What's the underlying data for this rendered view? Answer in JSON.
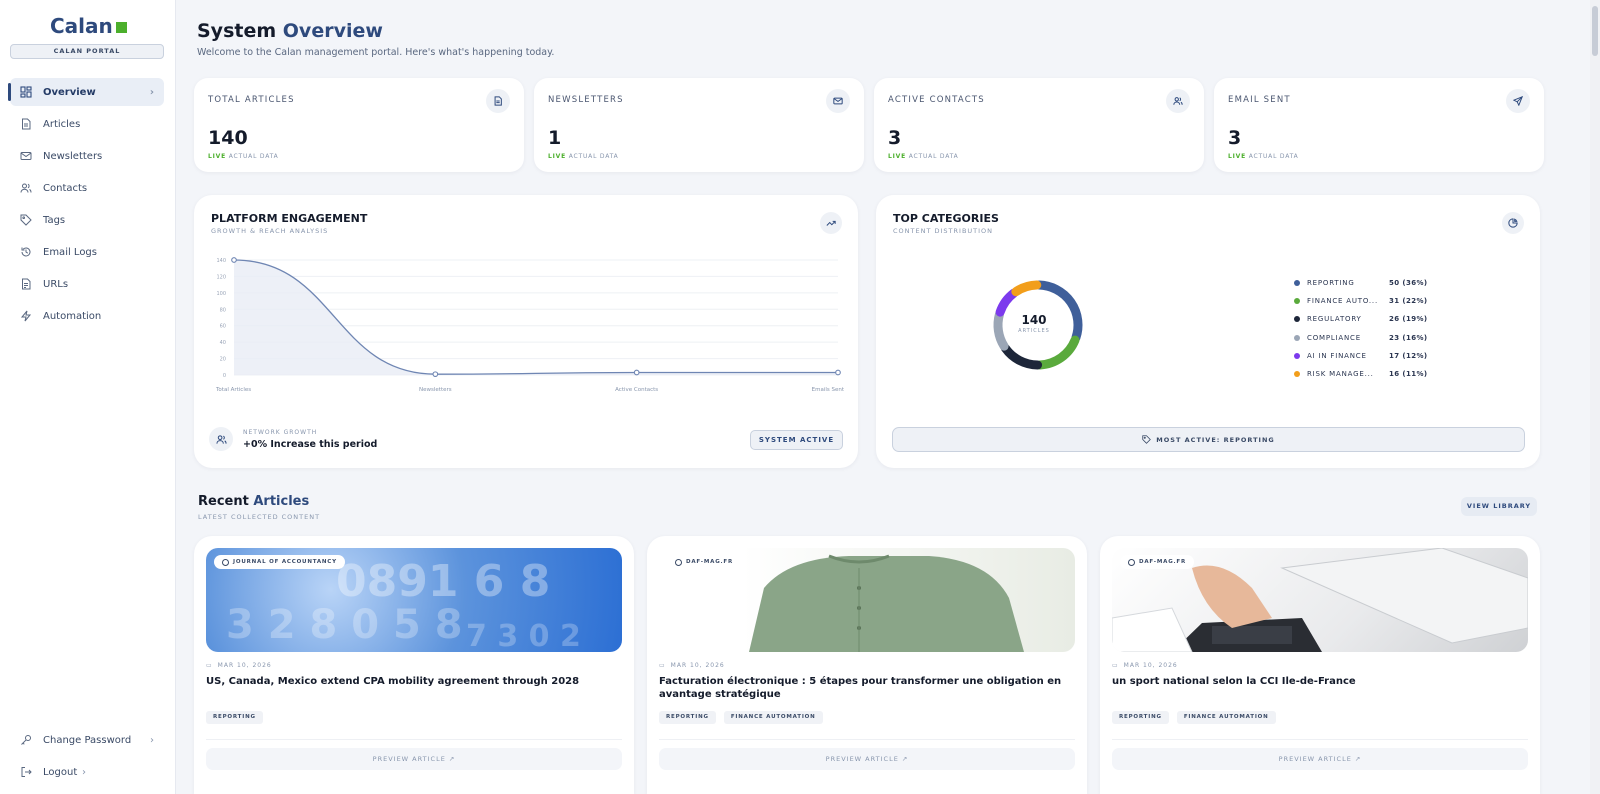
{
  "sidebar": {
    "logo": "Calan",
    "portal": "CALAN PORTAL",
    "items": [
      {
        "label": "Overview"
      },
      {
        "label": "Articles"
      },
      {
        "label": "Newsletters"
      },
      {
        "label": "Contacts"
      },
      {
        "label": "Tags"
      },
      {
        "label": "Email Logs"
      },
      {
        "label": "URLs"
      },
      {
        "label": "Automation"
      }
    ],
    "bottom": [
      {
        "label": "Change Password"
      },
      {
        "label": "Logout"
      }
    ]
  },
  "header": {
    "title_a": "System",
    "title_b": "Overview",
    "subtitle": "Welcome to the Calan management portal. Here's what's happening today."
  },
  "stats": [
    {
      "label": "TOTAL ARTICLES",
      "value": "140",
      "live": "LIVE",
      "foot": "ACTUAL DATA",
      "icon": "document-icon"
    },
    {
      "label": "NEWSLETTERS",
      "value": "1",
      "live": "LIVE",
      "foot": "ACTUAL DATA",
      "icon": "mail-icon"
    },
    {
      "label": "ACTIVE CONTACTS",
      "value": "3",
      "live": "LIVE",
      "foot": "ACTUAL DATA",
      "icon": "users-icon"
    },
    {
      "label": "EMAIL SENT",
      "value": "3",
      "live": "LIVE",
      "foot": "ACTUAL DATA",
      "icon": "send-icon"
    }
  ],
  "engagement": {
    "title": "PLATFORM ENGAGEMENT",
    "subtitle": "GROWTH & REACH ANALYSIS",
    "network_label": "NETWORK GROWTH",
    "network_value": "+0% Increase this period",
    "system_button": "SYSTEM ACTIVE"
  },
  "categories": {
    "title": "TOP CATEGORIES",
    "subtitle": "CONTENT DISTRIBUTION",
    "center_value": "140",
    "center_label": "ARTICLES",
    "most_active": "MOST ACTIVE: REPORTING"
  },
  "chart_data": [
    {
      "type": "area",
      "categories": [
        "Total Articles",
        "Newsletters",
        "Active Contacts",
        "Emails Sent"
      ],
      "values": [
        140,
        1,
        3,
        3
      ],
      "yticks": [
        0,
        20,
        40,
        60,
        80,
        100,
        120,
        140
      ],
      "ylim": [
        0,
        140
      ],
      "grid": true,
      "color": "#6f86b3"
    },
    {
      "type": "pie",
      "categories": [
        "REPORTING",
        "FINANCE AUTO...",
        "REGULATORY",
        "COMPLIANCE",
        "AI IN FINANCE",
        "RISK MANAGE..."
      ],
      "values": [
        50,
        31,
        26,
        23,
        17,
        16
      ],
      "labels": [
        "50 (36%)",
        "31 (22%)",
        "26 (19%)",
        "23 (16%)",
        "17 (12%)",
        "16 (11%)"
      ],
      "colors": [
        "#3f5f9a",
        "#5aaa3c",
        "#1d2639",
        "#9ba6b6",
        "#7c3aed",
        "#f29e1b"
      ],
      "legend": "right"
    }
  ],
  "recent": {
    "title_a": "Recent",
    "title_b": "Articles",
    "subtitle": "LATEST COLLECTED CONTENT",
    "view_library": "VIEW LIBRARY",
    "articles": [
      {
        "source": "JOURNAL OF ACCOUNTANCY",
        "date": "MAR 10, 2026",
        "title": "US, Canada, Mexico extend CPA mobility agreement through 2028",
        "tags": [
          "REPORTING"
        ],
        "button": "PREVIEW ARTICLE"
      },
      {
        "source": "DAF-MAG.FR",
        "date": "MAR 10, 2026",
        "title": "Facturation électronique : 5 étapes pour transformer une obligation en avantage stratégique",
        "tags": [
          "REPORTING",
          "FINANCE AUTOMATION"
        ],
        "button": "PREVIEW ARTICLE"
      },
      {
        "source": "DAF-MAG.FR",
        "date": "MAR 10, 2026",
        "title": "un sport national selon la CCI Ile-de-France",
        "tags": [
          "REPORTING",
          "FINANCE AUTOMATION"
        ],
        "button": "PREVIEW ARTICLE"
      }
    ]
  }
}
